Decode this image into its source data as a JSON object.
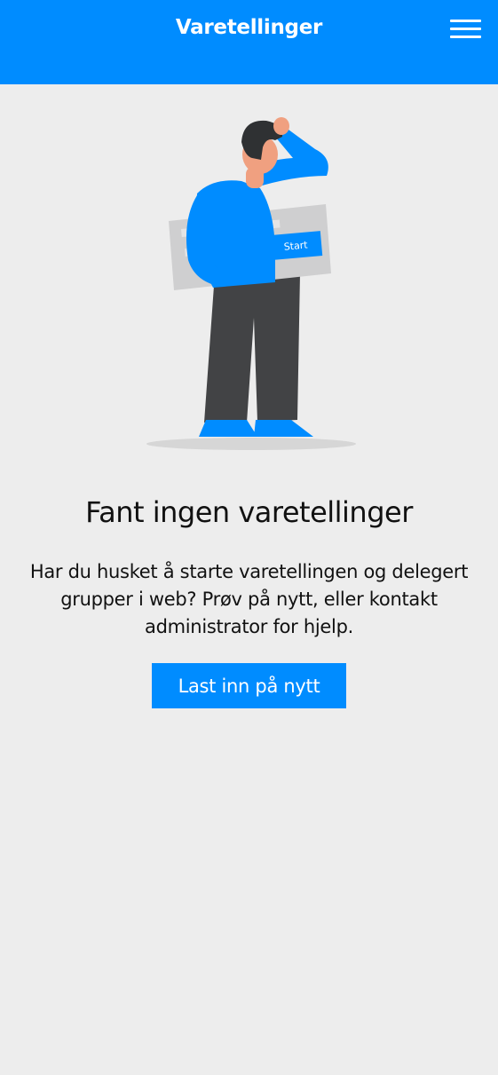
{
  "header": {
    "title": "Varetellinger",
    "menu_icon": "hamburger-menu-icon"
  },
  "illustration": {
    "icon": "confused-person-illustration",
    "card_button_label": "Start"
  },
  "empty_state": {
    "title": "Fant ingen varetellinger",
    "message": "Har du husket å starte varetellingen og delegert grupper i web? Prøv på nytt, eller kontakt administrator for hjelp.",
    "reload_button_label": "Last inn på nytt"
  },
  "colors": {
    "accent": "#008cff",
    "background": "#ededed",
    "text": "#111111"
  }
}
